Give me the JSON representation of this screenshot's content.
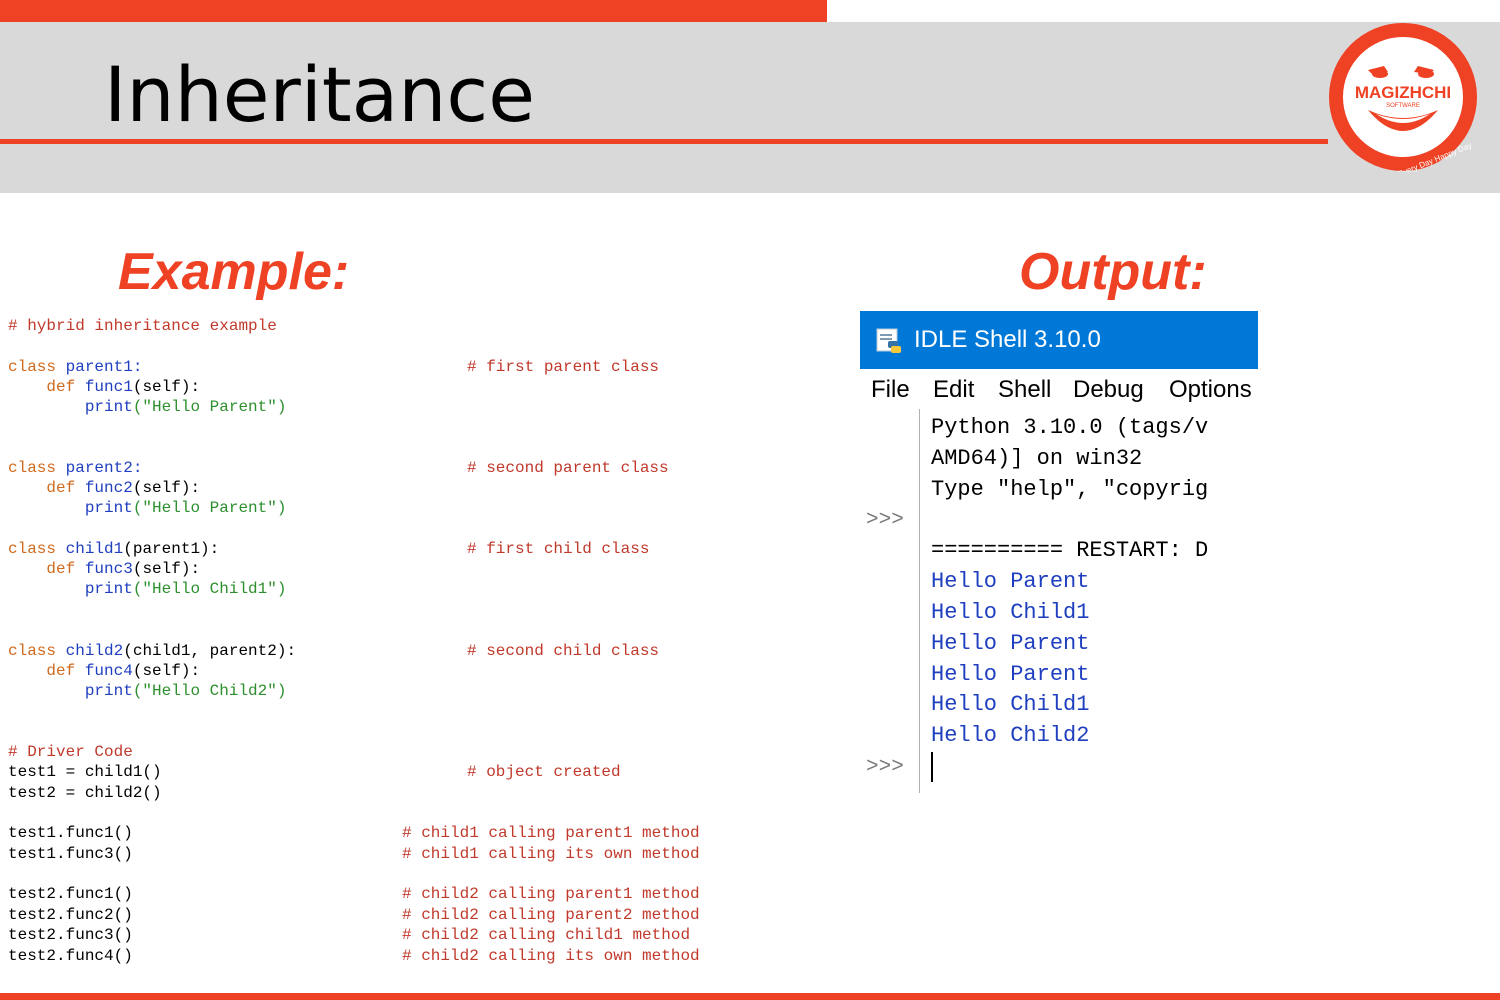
{
  "slide": {
    "title": "Inheritance",
    "example_heading": "Example:",
    "output_heading": "Output:",
    "accent_color": "#ef4123",
    "band_color": "#d9d9d9"
  },
  "logo": {
    "name": "MAGIZHCHI",
    "sub": "SOFTWARE",
    "tagline": "Every Day Happy Day",
    "icon": "smiling-face-logo"
  },
  "code": {
    "header_comment": "# hybrid inheritance example",
    "parent1_class": "class",
    "parent1_name": "parent1:",
    "parent1_comment": "# first parent class",
    "parent1_def": "def",
    "parent1_func": "func1",
    "parent1_args": "(self):",
    "parent1_print": "print",
    "parent1_str": "(\"Hello Parent\")",
    "parent2_class": "class",
    "parent2_name": "parent2:",
    "parent2_comment": "# second parent class",
    "parent2_def": "def",
    "parent2_func": "func2",
    "parent2_args": "(self):",
    "parent2_print": "print",
    "parent2_str": "(\"Hello Parent\")",
    "child1_class": "class",
    "child1_name": "child1",
    "child1_bases": "(parent1):",
    "child1_comment": "# first child class",
    "child1_def": "def",
    "child1_func": "func3",
    "child1_args": "(self):",
    "child1_print": "print",
    "child1_str": "(\"Hello Child1\")",
    "child2_class": "class",
    "child2_name": "child2",
    "child2_bases": "(child1, parent2):",
    "child2_comment": "# second child class",
    "child2_def": "def",
    "child2_func": "func4",
    "child2_args": "(self):",
    "child2_print": "print",
    "child2_str": "(\"Hello Child2\")",
    "driver_comment": "# Driver Code",
    "test1_assign": "test1 = child1()",
    "object_comment": "# object created",
    "test2_assign": "test2 = child2()",
    "calls": [
      {
        "code": "test1.func1()",
        "comment": "# child1 calling parent1 method"
      },
      {
        "code": "test1.func3()",
        "comment": "# child1 calling its own method"
      },
      {
        "code": "test2.func1()",
        "comment": "# child2 calling parent1 method"
      },
      {
        "code": "test2.func2()",
        "comment": "# child2 calling parent2 method"
      },
      {
        "code": "test2.func3()",
        "comment": "# child2 calling child1 method"
      },
      {
        "code": "test2.func4()",
        "comment": "# child2 calling its own method"
      }
    ]
  },
  "idle": {
    "title": "IDLE Shell 3.10.0",
    "icon": "python-idle-icon",
    "menu": [
      "File",
      "Edit",
      "Shell",
      "Debug",
      "Options"
    ],
    "prompt": ">>>",
    "banner": [
      "Python 3.10.0 (tags/v",
      "AMD64)] on win32",
      "Type \"help\", \"copyrig"
    ],
    "restart": "========== RESTART: D",
    "output": [
      "Hello Parent",
      "Hello Child1",
      "Hello Parent",
      "Hello Parent",
      "Hello Child1",
      "Hello Child2"
    ]
  }
}
